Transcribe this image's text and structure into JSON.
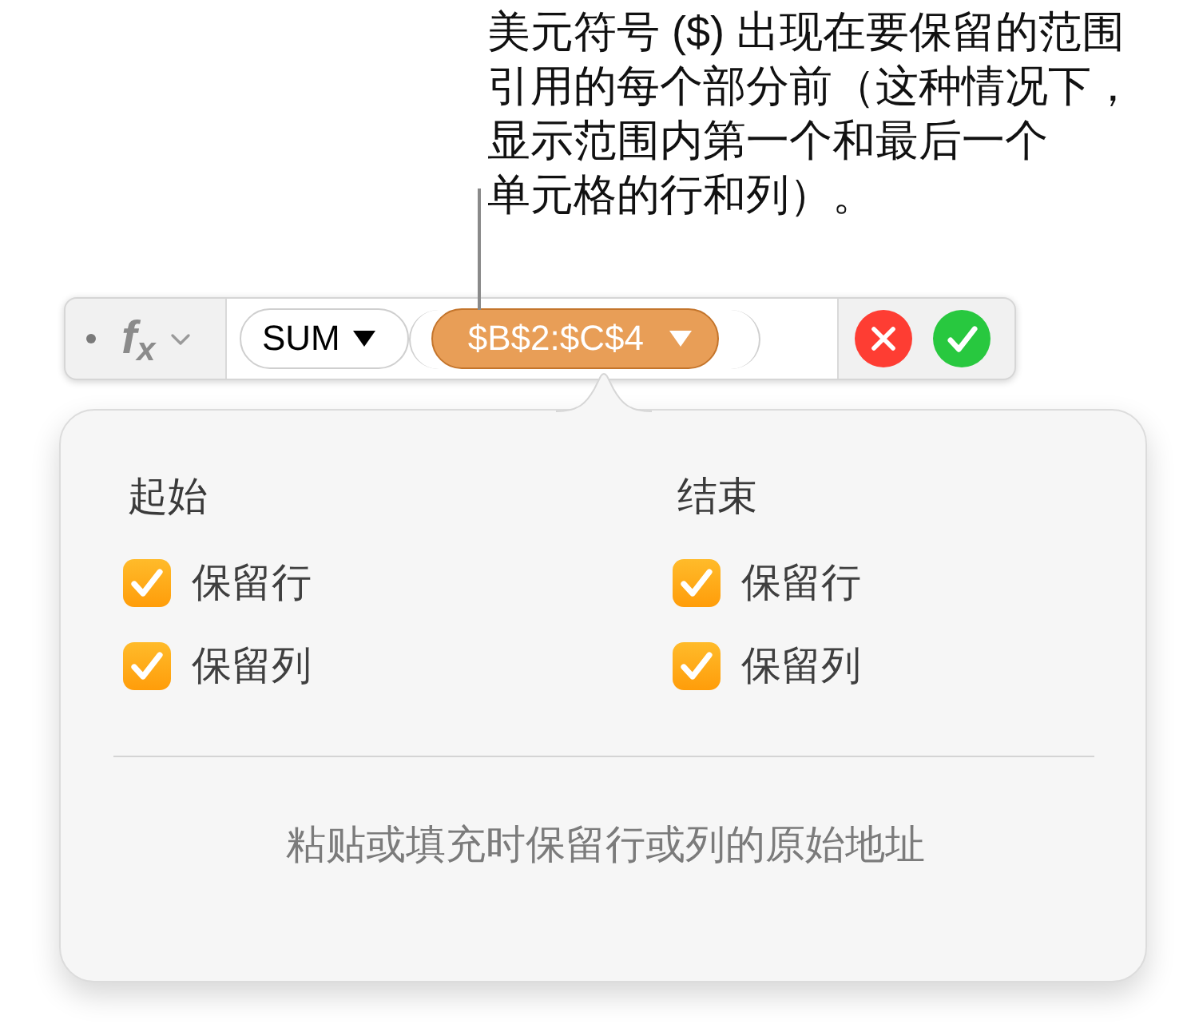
{
  "callout": {
    "text": "美元符号 ($) 出现在要保留的范围引用的每个部分前（这种情况下，显示范围内第一个和最后一个单元格的行和列）。"
  },
  "formula_bar": {
    "function_button": {
      "label": "f$_{x}$"
    },
    "tokens": [
      {
        "kind": "function",
        "label": "SUM",
        "selected": false
      },
      {
        "kind": "range",
        "label": "$B$2:$C$4",
        "selected": true
      }
    ],
    "buttons": [
      {
        "kind": "cancel"
      },
      {
        "kind": "accept"
      }
    ]
  },
  "popover": {
    "columns": [
      {
        "heading": "起始",
        "options": [
          {
            "label": "保留行",
            "checked": true
          },
          {
            "label": "保留列",
            "checked": true
          }
        ]
      },
      {
        "heading": "结束",
        "options": [
          {
            "label": "保留行",
            "checked": true
          },
          {
            "label": "保留列",
            "checked": true
          }
        ]
      }
    ],
    "hint": "粘贴或填充时保留行或列的原始地址"
  }
}
